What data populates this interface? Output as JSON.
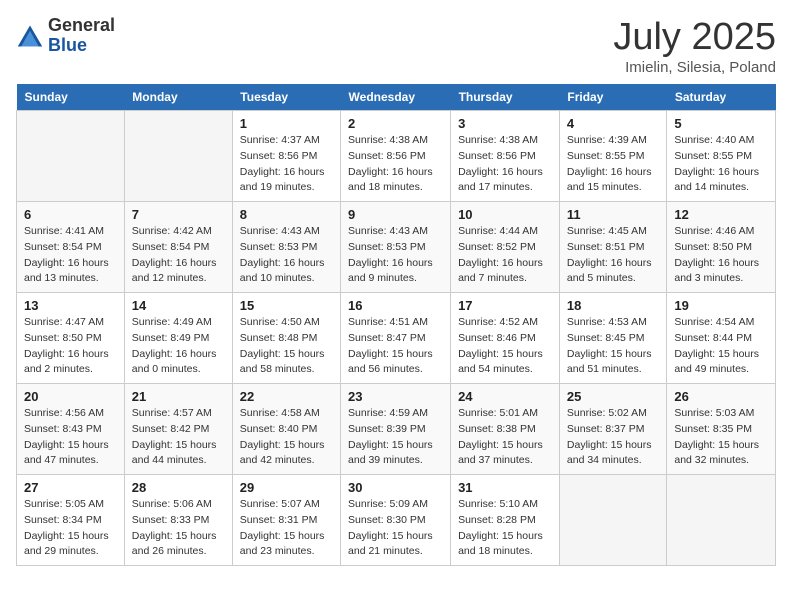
{
  "logo": {
    "general": "General",
    "blue": "Blue"
  },
  "title": "July 2025",
  "location": "Imielin, Silesia, Poland",
  "weekdays": [
    "Sunday",
    "Monday",
    "Tuesday",
    "Wednesday",
    "Thursday",
    "Friday",
    "Saturday"
  ],
  "weeks": [
    [
      {
        "day": "",
        "detail": ""
      },
      {
        "day": "",
        "detail": ""
      },
      {
        "day": "1",
        "detail": "Sunrise: 4:37 AM\nSunset: 8:56 PM\nDaylight: 16 hours and 19 minutes."
      },
      {
        "day": "2",
        "detail": "Sunrise: 4:38 AM\nSunset: 8:56 PM\nDaylight: 16 hours and 18 minutes."
      },
      {
        "day": "3",
        "detail": "Sunrise: 4:38 AM\nSunset: 8:56 PM\nDaylight: 16 hours and 17 minutes."
      },
      {
        "day": "4",
        "detail": "Sunrise: 4:39 AM\nSunset: 8:55 PM\nDaylight: 16 hours and 15 minutes."
      },
      {
        "day": "5",
        "detail": "Sunrise: 4:40 AM\nSunset: 8:55 PM\nDaylight: 16 hours and 14 minutes."
      }
    ],
    [
      {
        "day": "6",
        "detail": "Sunrise: 4:41 AM\nSunset: 8:54 PM\nDaylight: 16 hours and 13 minutes."
      },
      {
        "day": "7",
        "detail": "Sunrise: 4:42 AM\nSunset: 8:54 PM\nDaylight: 16 hours and 12 minutes."
      },
      {
        "day": "8",
        "detail": "Sunrise: 4:43 AM\nSunset: 8:53 PM\nDaylight: 16 hours and 10 minutes."
      },
      {
        "day": "9",
        "detail": "Sunrise: 4:43 AM\nSunset: 8:53 PM\nDaylight: 16 hours and 9 minutes."
      },
      {
        "day": "10",
        "detail": "Sunrise: 4:44 AM\nSunset: 8:52 PM\nDaylight: 16 hours and 7 minutes."
      },
      {
        "day": "11",
        "detail": "Sunrise: 4:45 AM\nSunset: 8:51 PM\nDaylight: 16 hours and 5 minutes."
      },
      {
        "day": "12",
        "detail": "Sunrise: 4:46 AM\nSunset: 8:50 PM\nDaylight: 16 hours and 3 minutes."
      }
    ],
    [
      {
        "day": "13",
        "detail": "Sunrise: 4:47 AM\nSunset: 8:50 PM\nDaylight: 16 hours and 2 minutes."
      },
      {
        "day": "14",
        "detail": "Sunrise: 4:49 AM\nSunset: 8:49 PM\nDaylight: 16 hours and 0 minutes."
      },
      {
        "day": "15",
        "detail": "Sunrise: 4:50 AM\nSunset: 8:48 PM\nDaylight: 15 hours and 58 minutes."
      },
      {
        "day": "16",
        "detail": "Sunrise: 4:51 AM\nSunset: 8:47 PM\nDaylight: 15 hours and 56 minutes."
      },
      {
        "day": "17",
        "detail": "Sunrise: 4:52 AM\nSunset: 8:46 PM\nDaylight: 15 hours and 54 minutes."
      },
      {
        "day": "18",
        "detail": "Sunrise: 4:53 AM\nSunset: 8:45 PM\nDaylight: 15 hours and 51 minutes."
      },
      {
        "day": "19",
        "detail": "Sunrise: 4:54 AM\nSunset: 8:44 PM\nDaylight: 15 hours and 49 minutes."
      }
    ],
    [
      {
        "day": "20",
        "detail": "Sunrise: 4:56 AM\nSunset: 8:43 PM\nDaylight: 15 hours and 47 minutes."
      },
      {
        "day": "21",
        "detail": "Sunrise: 4:57 AM\nSunset: 8:42 PM\nDaylight: 15 hours and 44 minutes."
      },
      {
        "day": "22",
        "detail": "Sunrise: 4:58 AM\nSunset: 8:40 PM\nDaylight: 15 hours and 42 minutes."
      },
      {
        "day": "23",
        "detail": "Sunrise: 4:59 AM\nSunset: 8:39 PM\nDaylight: 15 hours and 39 minutes."
      },
      {
        "day": "24",
        "detail": "Sunrise: 5:01 AM\nSunset: 8:38 PM\nDaylight: 15 hours and 37 minutes."
      },
      {
        "day": "25",
        "detail": "Sunrise: 5:02 AM\nSunset: 8:37 PM\nDaylight: 15 hours and 34 minutes."
      },
      {
        "day": "26",
        "detail": "Sunrise: 5:03 AM\nSunset: 8:35 PM\nDaylight: 15 hours and 32 minutes."
      }
    ],
    [
      {
        "day": "27",
        "detail": "Sunrise: 5:05 AM\nSunset: 8:34 PM\nDaylight: 15 hours and 29 minutes."
      },
      {
        "day": "28",
        "detail": "Sunrise: 5:06 AM\nSunset: 8:33 PM\nDaylight: 15 hours and 26 minutes."
      },
      {
        "day": "29",
        "detail": "Sunrise: 5:07 AM\nSunset: 8:31 PM\nDaylight: 15 hours and 23 minutes."
      },
      {
        "day": "30",
        "detail": "Sunrise: 5:09 AM\nSunset: 8:30 PM\nDaylight: 15 hours and 21 minutes."
      },
      {
        "day": "31",
        "detail": "Sunrise: 5:10 AM\nSunset: 8:28 PM\nDaylight: 15 hours and 18 minutes."
      },
      {
        "day": "",
        "detail": ""
      },
      {
        "day": "",
        "detail": ""
      }
    ]
  ]
}
